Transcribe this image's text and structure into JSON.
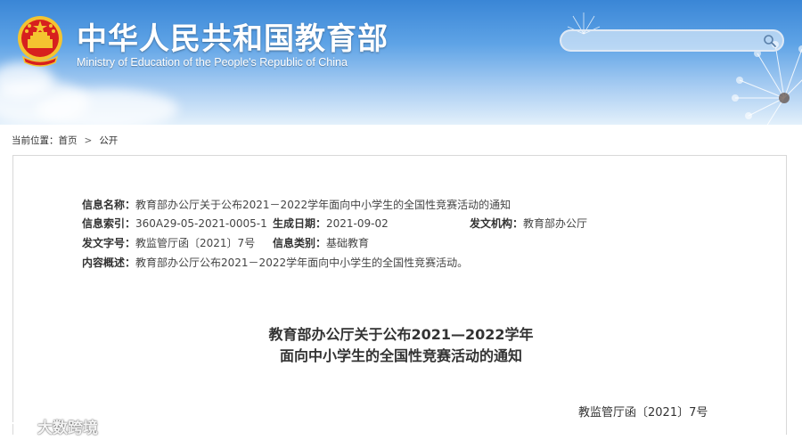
{
  "header": {
    "title_cn": "中华人民共和国教育部",
    "title_en": "Ministry of Education of the People's Republic of China",
    "emblem_icon": "national-emblem-icon",
    "search": {
      "placeholder": "",
      "value": "",
      "icon": "search-icon"
    }
  },
  "breadcrumb": {
    "prefix": "当前位置：",
    "items": [
      "首页",
      "公开"
    ],
    "separator": ">"
  },
  "meta": {
    "info_name_label": "信息名称：",
    "info_name_value": "教育部办公厅关于公布2021－2022学年面向中小学生的全国性竞赛活动的通知",
    "index_label": "信息索引：",
    "index_value": "360A29-05-2021-0005-1",
    "date_label": "生成日期：",
    "date_value": "2021-09-02",
    "issuer_label": "发文机构：",
    "issuer_value": "教育部办公厅",
    "doc_no_label": "发文字号：",
    "doc_no_value": "教监管厅函〔2021〕7号",
    "category_label": "信息类别：",
    "category_value": "基础教育",
    "summary_label": "内容概述：",
    "summary_value": "教育部办公厅公布2021－2022学年面向中小学生的全国性竞赛活动。"
  },
  "document": {
    "title_line1": "教育部办公厅关于公布2021—2022学年",
    "title_line2": "面向中小学生的全国性竞赛活动的通知",
    "doc_number": "教监管厅函〔2021〕7号"
  },
  "watermark": {
    "text": "大数跨境"
  },
  "colors": {
    "header_top": "#3a86d6",
    "header_bottom": "#e3f0fb",
    "emblem_red": "#d7201e",
    "emblem_gold": "#f4c430"
  }
}
